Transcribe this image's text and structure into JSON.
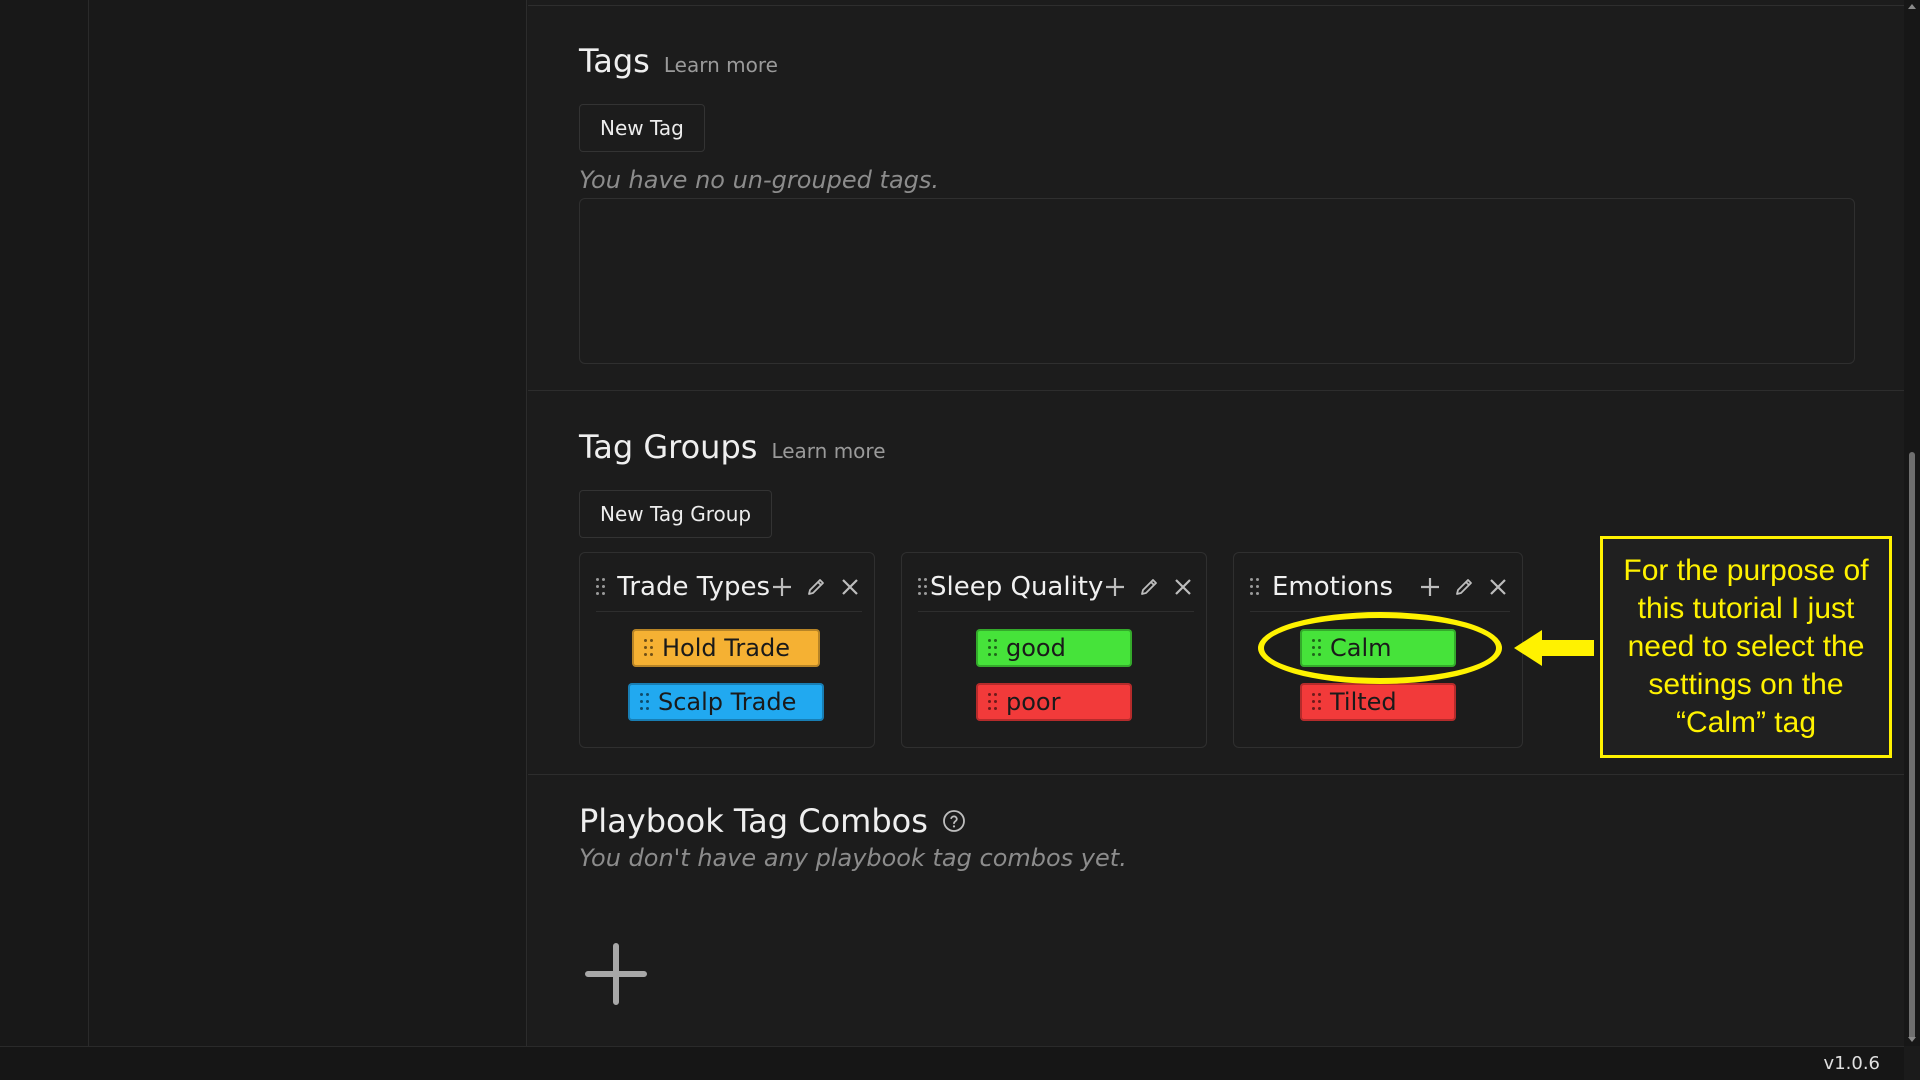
{
  "tags": {
    "title": "Tags",
    "learn_more": "Learn more",
    "new_tag_button": "New Tag",
    "empty_message": "You have no un-grouped tags."
  },
  "tag_groups": {
    "title": "Tag Groups",
    "learn_more": "Learn more",
    "new_group_button": "New Tag Group",
    "groups": [
      {
        "name": "Trade Types",
        "tags": [
          {
            "label": "Hold Trade",
            "color": "#f5b133"
          },
          {
            "label": "Scalp Trade",
            "color": "#21a9f0"
          }
        ]
      },
      {
        "name": "Sleep Quality",
        "tags": [
          {
            "label": "good",
            "color": "#46e33a"
          },
          {
            "label": "poor",
            "color": "#f23a3a"
          }
        ]
      },
      {
        "name": "Emotions",
        "tags": [
          {
            "label": "Calm",
            "color": "#46e33a"
          },
          {
            "label": "Tilted",
            "color": "#f23a3a"
          }
        ]
      }
    ]
  },
  "playbook": {
    "title": "Playbook Tag Combos",
    "empty_message": "You don't have any playbook tag combos yet."
  },
  "annotation": {
    "text": "For the purpose of this tutorial I just need to select the settings on the “Calm” tag",
    "color": "#fff200"
  },
  "footer": {
    "version": "v1.0.6"
  }
}
